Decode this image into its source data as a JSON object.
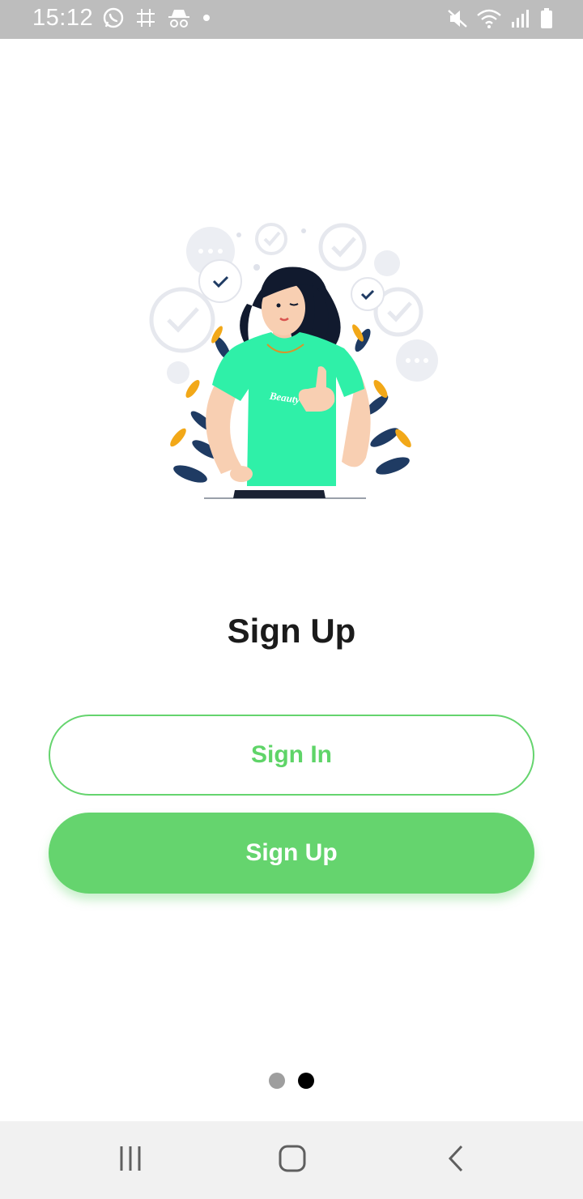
{
  "status_bar": {
    "time": "15:12",
    "left_icons": [
      "whatsapp-icon",
      "grid-hash-icon",
      "incognito-icon",
      "notification-dot-icon"
    ],
    "right_icons": [
      "mute-icon",
      "wifi-icon",
      "signal-icon",
      "battery-icon"
    ]
  },
  "illustration": {
    "shirt_text": "Beauty"
  },
  "page": {
    "title": "Sign Up"
  },
  "buttons": {
    "sign_in": "Sign In",
    "sign_up": "Sign Up"
  },
  "pager": {
    "count": 2,
    "active_index": 1
  },
  "navigation": {
    "icons": [
      "recent-apps-icon",
      "home-icon",
      "back-icon"
    ]
  },
  "colors": {
    "accent": "#65d46e",
    "title": "#1b1b1b",
    "status_bar": "#bdbdbd",
    "nav_bar": "#f1f1f1",
    "shirt": "#2ff0a8",
    "leaf_dark": "#1f3b63",
    "leaf_orange": "#f2a818"
  }
}
